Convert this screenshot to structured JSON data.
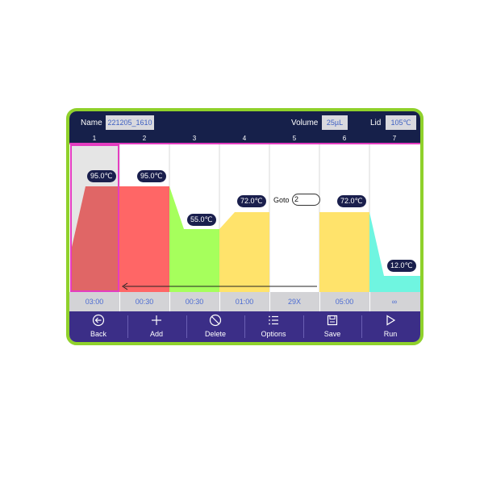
{
  "header": {
    "name_label": "Name",
    "name_value": "221205_1610",
    "volume_label": "Volume",
    "volume_value": "25µL",
    "lid_label": "Lid",
    "lid_value": "105℃"
  },
  "steps": [
    {
      "number": "1",
      "temp": "95.0℃",
      "time": "03:00",
      "color": "#e06666"
    },
    {
      "number": "2",
      "temp": "95.0℃",
      "time": "00:30",
      "color": "#ff6666"
    },
    {
      "number": "3",
      "temp": "55.0℃",
      "time": "00:30",
      "color": "#a6ff5c"
    },
    {
      "number": "4",
      "temp": "72.0℃",
      "time": "01:00",
      "color": "#ffe36b"
    },
    {
      "number": "5",
      "goto_label": "Goto",
      "goto_value": "2",
      "time": "29X"
    },
    {
      "number": "6",
      "temp": "72.0℃",
      "time": "05:00",
      "color": "#ffe36b"
    },
    {
      "number": "7",
      "temp": "12.0℃",
      "time": "∞",
      "color": "#6ff5e0"
    }
  ],
  "colors": {
    "frame": "#8fd12b",
    "header_bg": "#16204a",
    "toolbar_bg": "#3b2e87",
    "selection": "#e43dc0",
    "time_text": "#4b6bd2"
  },
  "toolbar": {
    "back": {
      "label": "Back",
      "icon": "back-arrow-circle-icon"
    },
    "add": {
      "label": "Add",
      "icon": "plus-icon"
    },
    "delete": {
      "label": "Delete",
      "icon": "prohibit-icon"
    },
    "options": {
      "label": "Options",
      "icon": "list-icon"
    },
    "save": {
      "label": "Save",
      "icon": "floppy-disk-icon"
    },
    "run": {
      "label": "Run",
      "icon": "play-triangle-icon"
    }
  }
}
